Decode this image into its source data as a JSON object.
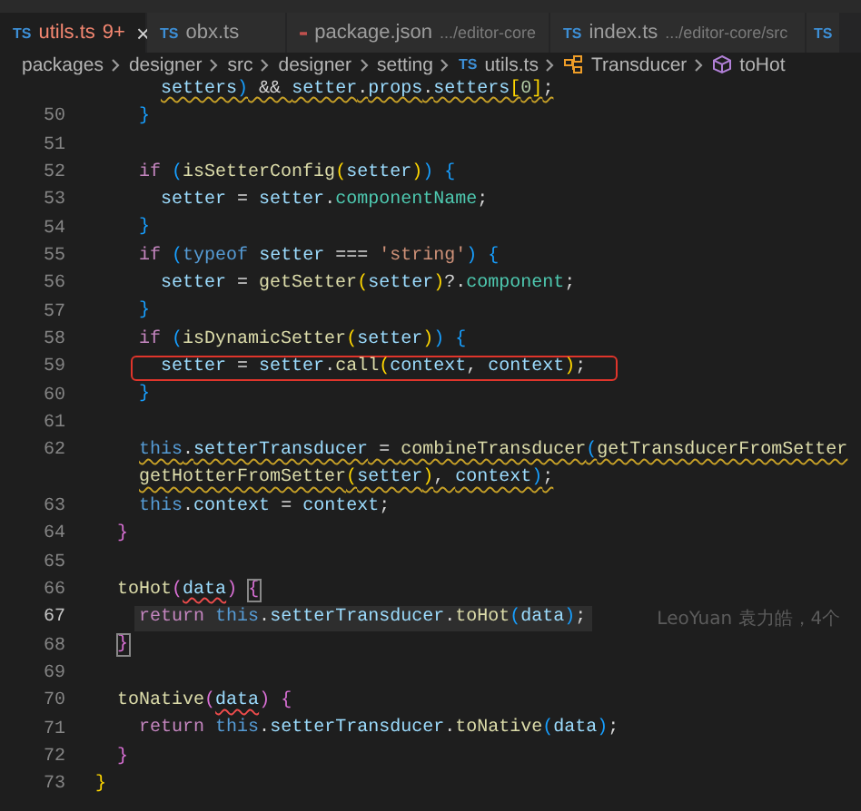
{
  "tabs": [
    {
      "kind": "ts",
      "icon_text": "TS",
      "label": "utils.ts",
      "badge": "9+",
      "close": "×",
      "selected": true
    },
    {
      "kind": "ts",
      "icon_text": "TS",
      "label": "obx.ts",
      "selected": false
    },
    {
      "kind": "json",
      "label": "package.json",
      "path": ".../editor-core",
      "selected": false
    },
    {
      "kind": "ts",
      "icon_text": "TS",
      "label": "index.ts",
      "path": ".../editor-core/src",
      "selected": false
    },
    {
      "kind": "ts",
      "icon_text": "TS",
      "selected": false
    }
  ],
  "breadcrumb": [
    {
      "kind": "folder",
      "label": "packages"
    },
    {
      "kind": "folder",
      "label": "designer"
    },
    {
      "kind": "folder",
      "label": "src"
    },
    {
      "kind": "folder",
      "label": "designer"
    },
    {
      "kind": "folder",
      "label": "setting"
    },
    {
      "kind": "ts",
      "icon_text": "TS",
      "label": "utils.ts"
    },
    {
      "kind": "class",
      "label": "Transducer"
    },
    {
      "kind": "method",
      "label": "toHot"
    }
  ],
  "lines": [
    {
      "current": false,
      "boxed": false,
      "warning": true,
      "tokens": [
        {
          "text": "      setters",
          "kind": "var"
        },
        {
          "text": ")",
          "kind": "b3"
        },
        {
          "text": " && ",
          "kind": "op"
        },
        {
          "text": "setter",
          "kind": "var"
        },
        {
          "text": ".",
          "kind": "op"
        },
        {
          "text": "props",
          "kind": "var"
        },
        {
          "text": ".",
          "kind": "op"
        },
        {
          "text": "setters",
          "kind": "var"
        },
        {
          "text": "[",
          "kind": "b1"
        },
        {
          "text": "0",
          "kind": "num"
        },
        {
          "text": "]",
          "kind": "b1"
        },
        {
          "text": ";",
          "kind": "op"
        }
      ]
    },
    {
      "number": "50",
      "current": false,
      "boxed": false,
      "warning": false,
      "tokens": [
        {
          "text": "    }",
          "kind": "b3"
        }
      ]
    },
    {
      "number": "51"
    },
    {
      "number": "52",
      "current": false,
      "boxed": false,
      "warning": false,
      "tokens": [
        {
          "text": "    if ",
          "kind": "control"
        },
        {
          "text": "(",
          "kind": "b3"
        },
        {
          "text": "isSetterConfig",
          "kind": "fn"
        },
        {
          "text": "(",
          "kind": "b1"
        },
        {
          "text": "setter",
          "kind": "var"
        },
        {
          "text": ")",
          "kind": "b1"
        },
        {
          "text": ")",
          "kind": "b3"
        },
        {
          "text": " {",
          "kind": "b3"
        }
      ]
    },
    {
      "number": "53",
      "current": false,
      "boxed": false,
      "warning": false,
      "tokens": [
        {
          "text": "      setter",
          "kind": "var"
        },
        {
          "text": " = ",
          "kind": "op"
        },
        {
          "text": "setter",
          "kind": "var"
        },
        {
          "text": ".",
          "kind": "op"
        },
        {
          "text": "componentName",
          "kind": "member"
        },
        {
          "text": ";",
          "kind": "op"
        }
      ]
    },
    {
      "number": "54",
      "current": false,
      "boxed": false,
      "warning": false,
      "tokens": [
        {
          "text": "    }",
          "kind": "b3"
        }
      ]
    },
    {
      "number": "55",
      "current": false,
      "boxed": false,
      "warning": false,
      "tokens": [
        {
          "text": "    if ",
          "kind": "control"
        },
        {
          "text": "(",
          "kind": "b3"
        },
        {
          "text": "typeof ",
          "kind": "keyword"
        },
        {
          "text": "setter",
          "kind": "var"
        },
        {
          "text": " === ",
          "kind": "op"
        },
        {
          "text": "'string'",
          "kind": "str"
        },
        {
          "text": ")",
          "kind": "b3"
        },
        {
          "text": " {",
          "kind": "b3"
        }
      ]
    },
    {
      "number": "56",
      "current": false,
      "boxed": false,
      "warning": false,
      "tokens": [
        {
          "text": "      setter",
          "kind": "var"
        },
        {
          "text": " = ",
          "kind": "op"
        },
        {
          "text": "getSetter",
          "kind": "fn"
        },
        {
          "text": "(",
          "kind": "b1"
        },
        {
          "text": "setter",
          "kind": "var"
        },
        {
          "text": ")",
          "kind": "b1"
        },
        {
          "text": "?.",
          "kind": "op"
        },
        {
          "text": "component",
          "kind": "member"
        },
        {
          "text": ";",
          "kind": "op"
        }
      ]
    },
    {
      "number": "57",
      "current": false,
      "boxed": false,
      "warning": false,
      "tokens": [
        {
          "text": "    }",
          "kind": "b3"
        }
      ]
    },
    {
      "number": "58",
      "current": false,
      "boxed": false,
      "warning": false,
      "tokens": [
        {
          "text": "    if ",
          "kind": "control"
        },
        {
          "text": "(",
          "kind": "b3"
        },
        {
          "text": "isDynamicSetter",
          "kind": "fn"
        },
        {
          "text": "(",
          "kind": "b1"
        },
        {
          "text": "setter",
          "kind": "var"
        },
        {
          "text": ")",
          "kind": "b1"
        },
        {
          "text": ")",
          "kind": "b3"
        },
        {
          "text": " {",
          "kind": "b3"
        }
      ]
    },
    {
      "number": "59",
      "current": false,
      "boxed": true,
      "warning": false,
      "tokens": [
        {
          "text": "      setter",
          "kind": "var"
        },
        {
          "text": " = ",
          "kind": "op"
        },
        {
          "text": "setter",
          "kind": "var"
        },
        {
          "text": ".",
          "kind": "op"
        },
        {
          "text": "call",
          "kind": "fn"
        },
        {
          "text": "(",
          "kind": "b1"
        },
        {
          "text": "context",
          "kind": "var"
        },
        {
          "text": ", ",
          "kind": "op"
        },
        {
          "text": "context",
          "kind": "var"
        },
        {
          "text": ")",
          "kind": "b1"
        },
        {
          "text": ";",
          "kind": "op"
        }
      ]
    },
    {
      "number": "60",
      "current": false,
      "boxed": false,
      "warning": false,
      "tokens": [
        {
          "text": "    }",
          "kind": "b3"
        }
      ]
    },
    {
      "number": "61"
    },
    {
      "number": "62",
      "current": false,
      "boxed": false,
      "warning": true,
      "tokens": [
        {
          "text": "    this",
          "kind": "keyword"
        },
        {
          "text": ".",
          "kind": "op"
        },
        {
          "text": "setterTransducer",
          "kind": "var"
        },
        {
          "text": " = ",
          "kind": "op"
        },
        {
          "text": "combineTransducer",
          "kind": "fn"
        },
        {
          "text": "(",
          "kind": "b3"
        },
        {
          "text": "getTransducerFromSetter",
          "kind": "fn"
        }
      ]
    },
    {
      "current": false,
      "boxed": false,
      "warning": true,
      "tokens": [
        {
          "text": "    getHotterFromSetter",
          "kind": "fn"
        },
        {
          "text": "(",
          "kind": "b1"
        },
        {
          "text": "setter",
          "kind": "var"
        },
        {
          "text": ")",
          "kind": "b1"
        },
        {
          "text": ", ",
          "kind": "op"
        },
        {
          "text": "context",
          "kind": "var"
        },
        {
          "text": ")",
          "kind": "b3"
        },
        {
          "text": ";",
          "kind": "op"
        }
      ]
    },
    {
      "number": "63",
      "current": false,
      "boxed": false,
      "warning": false,
      "tokens": [
        {
          "text": "    this",
          "kind": "keyword"
        },
        {
          "text": ".",
          "kind": "op"
        },
        {
          "text": "context",
          "kind": "var"
        },
        {
          "text": " = ",
          "kind": "op"
        },
        {
          "text": "context",
          "kind": "var"
        },
        {
          "text": ";",
          "kind": "op"
        }
      ]
    },
    {
      "number": "64",
      "current": false,
      "boxed": false,
      "warning": false,
      "tokens": [
        {
          "text": "  }",
          "kind": "b2"
        }
      ]
    },
    {
      "number": "65"
    },
    {
      "number": "66",
      "current": false,
      "boxed": false,
      "warning": false,
      "tokens": [
        {
          "text": "  toHot",
          "kind": "fn"
        },
        {
          "text": "(",
          "kind": "b2"
        },
        {
          "text": "data",
          "kind": "var_error"
        },
        {
          "text": ") ",
          "kind": "b2"
        },
        {
          "text": "{",
          "kind": "b2_match"
        }
      ]
    },
    {
      "number": "67",
      "current": true,
      "boxed": false,
      "warning": false,
      "blame": "LeoYuan 袁力皓，4个",
      "tokens": [
        {
          "text": "    return ",
          "kind": "control"
        },
        {
          "text": "this",
          "kind": "keyword"
        },
        {
          "text": ".",
          "kind": "op"
        },
        {
          "text": "setterTransducer",
          "kind": "var"
        },
        {
          "text": ".",
          "kind": "op"
        },
        {
          "text": "toHot",
          "kind": "fn"
        },
        {
          "text": "(",
          "kind": "b3"
        },
        {
          "text": "data",
          "kind": "var"
        },
        {
          "text": ")",
          "kind": "b3"
        },
        {
          "text": ";",
          "kind": "op"
        }
      ]
    },
    {
      "number": "68",
      "current": false,
      "boxed": false,
      "warning": false,
      "tokens": [
        {
          "text": "  }",
          "kind": "b2_match"
        }
      ]
    },
    {
      "number": "69"
    },
    {
      "number": "70",
      "current": false,
      "boxed": false,
      "warning": false,
      "tokens": [
        {
          "text": "  toNative",
          "kind": "fn"
        },
        {
          "text": "(",
          "kind": "b2"
        },
        {
          "text": "data",
          "kind": "var_error"
        },
        {
          "text": ")",
          "kind": "b2"
        },
        {
          "text": " {",
          "kind": "b2"
        }
      ]
    },
    {
      "number": "71",
      "current": false,
      "boxed": false,
      "warning": false,
      "tokens": [
        {
          "text": "    return ",
          "kind": "control"
        },
        {
          "text": "this",
          "kind": "keyword"
        },
        {
          "text": ".",
          "kind": "op"
        },
        {
          "text": "setterTransducer",
          "kind": "var"
        },
        {
          "text": ".",
          "kind": "op"
        },
        {
          "text": "toNative",
          "kind": "fn"
        },
        {
          "text": "(",
          "kind": "b3"
        },
        {
          "text": "data",
          "kind": "var"
        },
        {
          "text": ")",
          "kind": "b3"
        },
        {
          "text": ";",
          "kind": "op"
        }
      ]
    },
    {
      "number": "72",
      "current": false,
      "boxed": false,
      "warning": false,
      "tokens": [
        {
          "text": "  }",
          "kind": "b2"
        }
      ]
    },
    {
      "number": "73",
      "current": false,
      "boxed": false,
      "warning": false,
      "tokens": [
        {
          "text": "}",
          "kind": "b1"
        }
      ]
    }
  ]
}
